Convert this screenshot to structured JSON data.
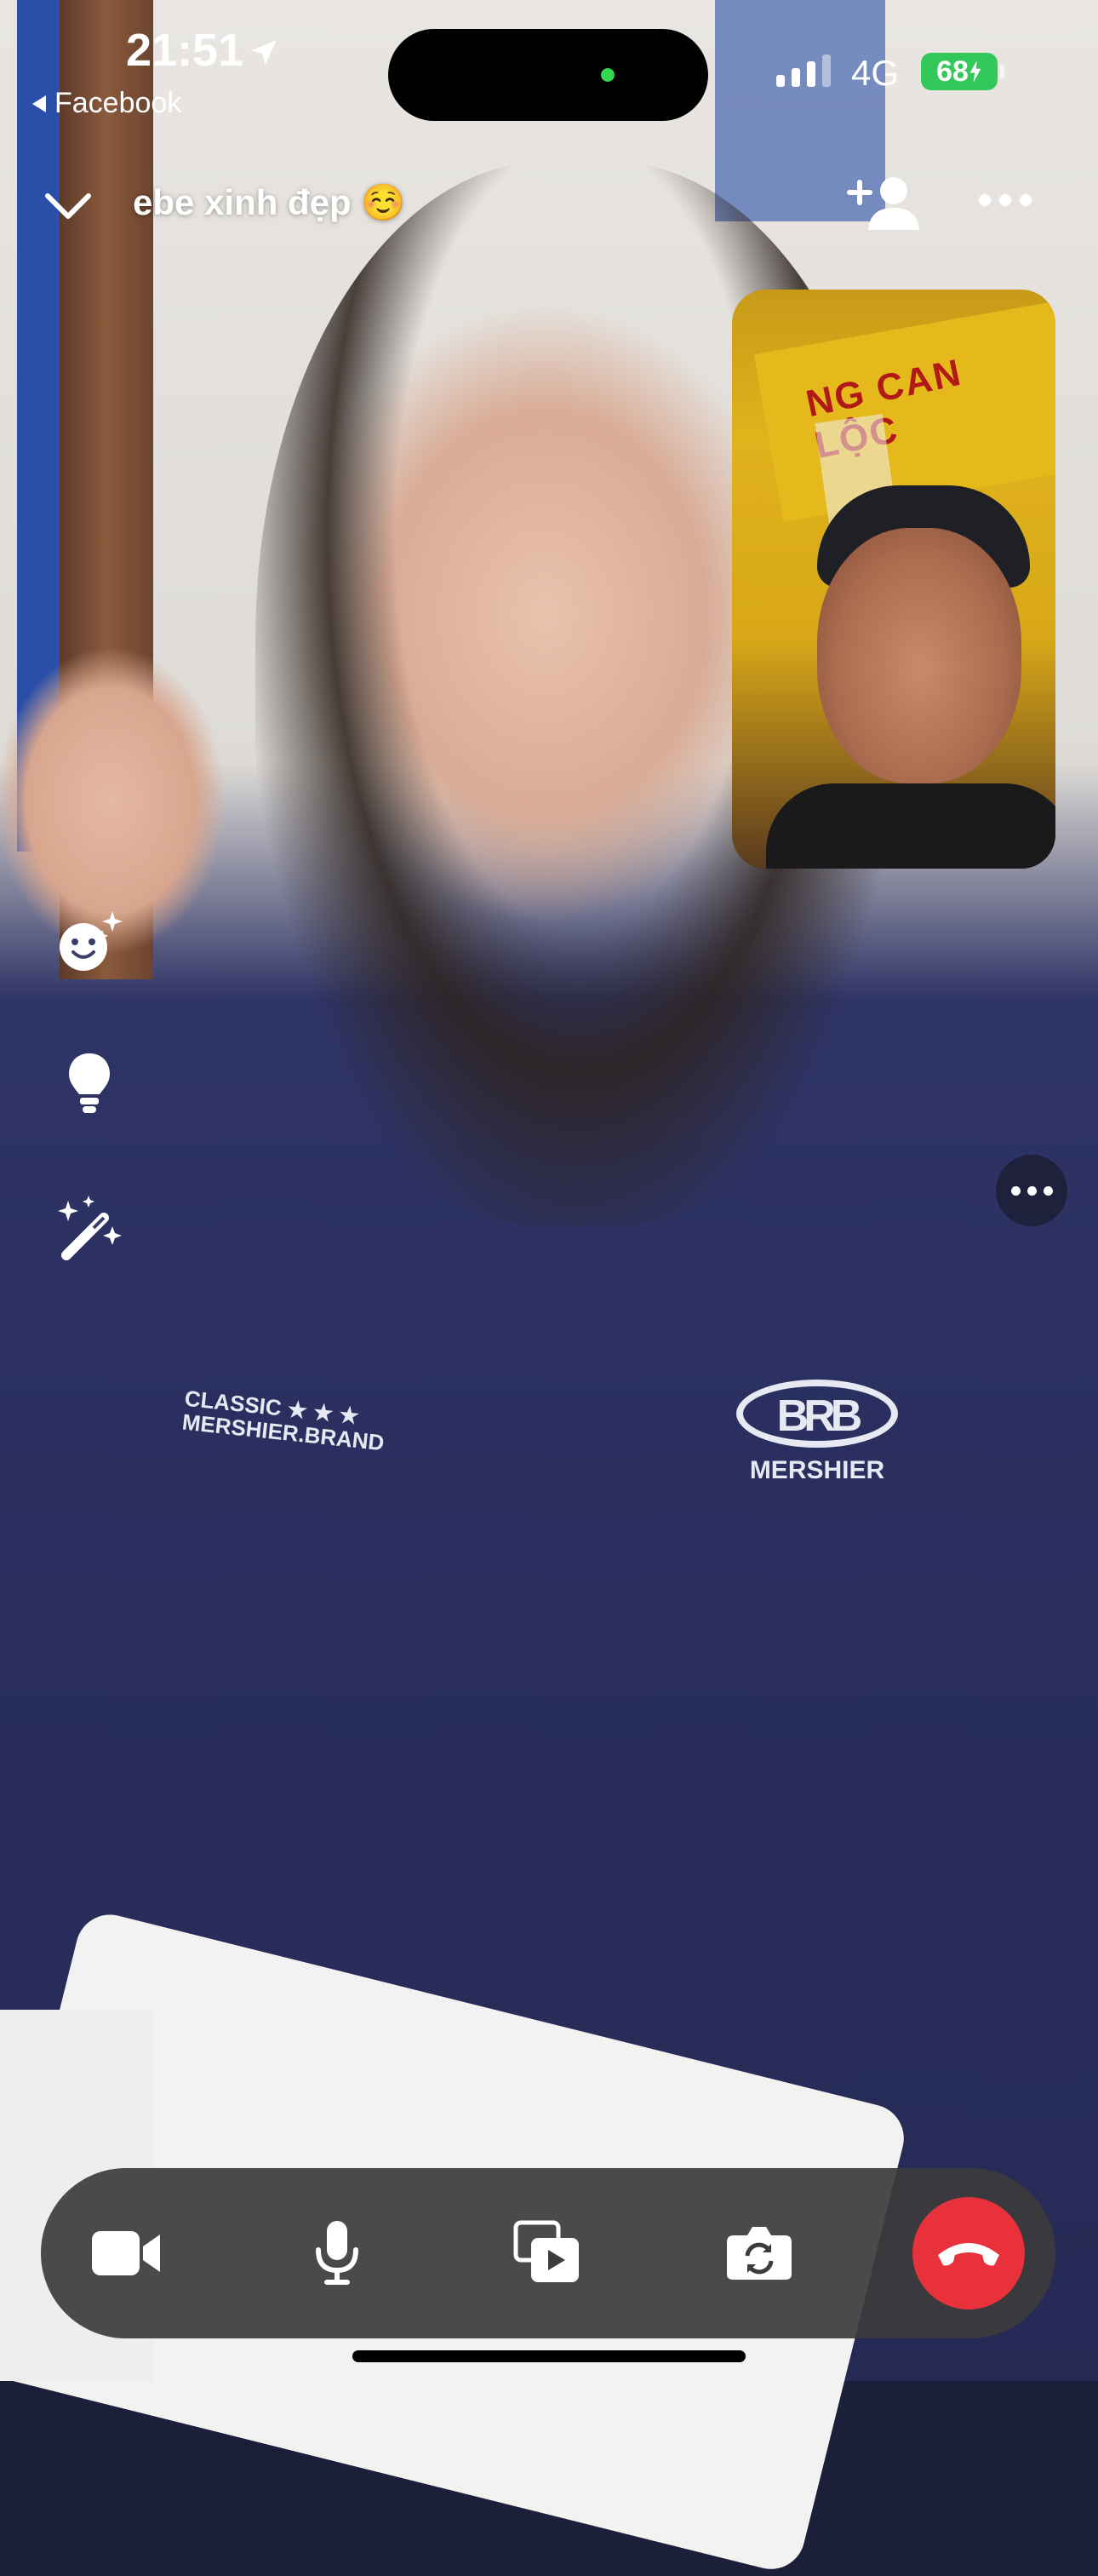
{
  "status_bar": {
    "time": "21:51",
    "back_app": "Facebook",
    "network": "4G",
    "battery": "68"
  },
  "call": {
    "title": "ebe xinh đẹp ☺️"
  },
  "video": {
    "shirt_text_1": "CLASSIC ★ ★ ★",
    "shirt_text_2": "MERSHIER.BRAND",
    "shirt_logo": "BRB",
    "shirt_brand": "MERSHIER",
    "pip_sign": "NG CAN LỘC"
  },
  "icons": {
    "back": "chevron-down-icon",
    "add_person": "add-person-icon",
    "more": "more-icon",
    "effects": "emoji-sparkle-icon",
    "lightbulb": "lightbulb-icon",
    "magic": "magic-wand-icon",
    "camera": "video-camera-icon",
    "mic": "microphone-icon",
    "share": "share-media-icon",
    "flip": "flip-camera-icon",
    "end": "end-call-icon"
  },
  "colors": {
    "end_call": "#e8313a",
    "battery": "#34c759",
    "island_indicator": "#33d74b"
  }
}
